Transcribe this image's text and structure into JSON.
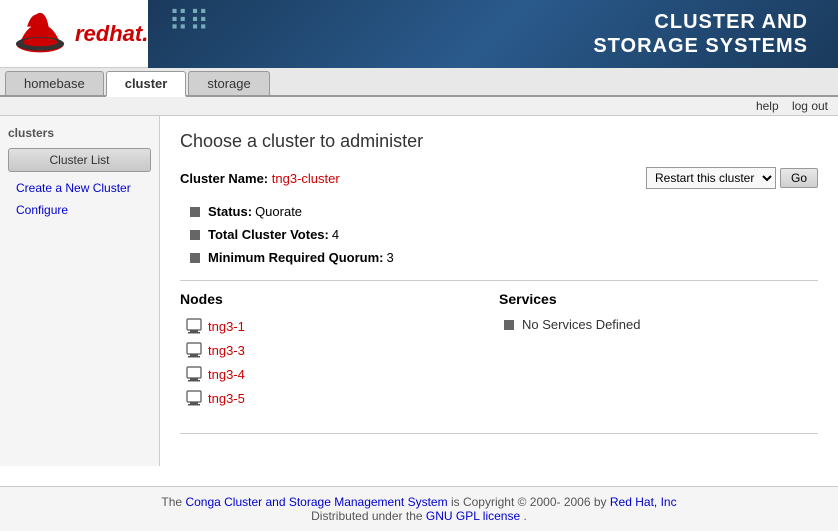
{
  "header": {
    "redhat_text": "redhat",
    "banner_title_line1": "CLUSTER AND",
    "banner_title_line2": "STORAGE SYSTEMS"
  },
  "nav": {
    "tabs": [
      {
        "label": "homebase",
        "active": false
      },
      {
        "label": "cluster",
        "active": true
      },
      {
        "label": "storage",
        "active": false
      }
    ],
    "help_link": "help",
    "logout_link": "log out"
  },
  "sidebar": {
    "section_title": "clusters",
    "cluster_list_btn": "Cluster List",
    "create_link": "Create a New Cluster",
    "configure_link": "Configure"
  },
  "main": {
    "page_title": "Choose a cluster to administer",
    "cluster_name_label": "Cluster Name:",
    "cluster_name_value": "tng3-cluster",
    "restart_option": "Restart this cluster",
    "go_button": "Go",
    "status_label": "Status:",
    "status_value": "Quorate",
    "total_votes_label": "Total Cluster Votes:",
    "total_votes_value": "4",
    "min_quorum_label": "Minimum Required Quorum:",
    "min_quorum_value": "3",
    "nodes_header": "Nodes",
    "services_header": "Services",
    "nodes": [
      {
        "name": "tng3-1"
      },
      {
        "name": "tng3-3"
      },
      {
        "name": "tng3-4"
      },
      {
        "name": "tng3-5"
      }
    ],
    "no_services": "No Services Defined"
  },
  "footer": {
    "text_before": "The",
    "link_text": "Conga Cluster and Storage Management System",
    "text_after": "is Copyright © 2000- 2006 by",
    "company": "Red Hat, Inc",
    "distributed": "Distributed under the",
    "license_link": "GNU GPL license",
    "period": "."
  }
}
